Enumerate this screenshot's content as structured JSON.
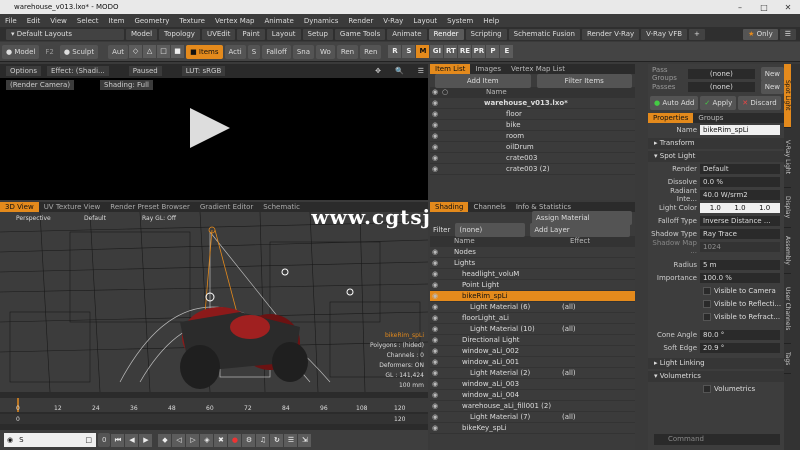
{
  "window": {
    "title": "warehouse_v013.lxo* - MODO"
  },
  "menu": [
    "File",
    "Edit",
    "View",
    "Select",
    "Item",
    "Geometry",
    "Texture",
    "Vertex Map",
    "Animate",
    "Dynamics",
    "Render",
    "V-Ray",
    "Layout",
    "System",
    "Help"
  ],
  "layouts": {
    "default_label": "Default Layouts",
    "tabs": [
      "Model",
      "Topology",
      "UVEdit",
      "Paint",
      "Layout",
      "Setup",
      "Game Tools",
      "Animate",
      "Render",
      "Scripting",
      "Schematic Fusion",
      "Render V-Ray",
      "V-Ray VFB"
    ],
    "active": "Render",
    "only_label": "Only"
  },
  "toolbar": {
    "model": "Model",
    "f2": "F2",
    "sculpt": "Sculpt",
    "auto": "Aut",
    "items": "Items",
    "action": "Acti",
    "s": "S",
    "falloff": "Falloff",
    "snap": "Sna",
    "wo": "Wo",
    "ren1": "Ren",
    "ren2": "Ren",
    "letters": [
      "R",
      "S",
      "M",
      "GI",
      "RT",
      "RE",
      "PR",
      "P",
      "E"
    ]
  },
  "render_view": {
    "options": "Options",
    "effect": "Effect: (Shadi...",
    "status": "Paused",
    "lut": "LUT: sRGB",
    "camera": "(Render Camera)",
    "shading": "Shading: Full"
  },
  "viewport": {
    "tabs": [
      "3D View",
      "UV Texture View",
      "Render Preset Browser",
      "Gradient Editor",
      "Schematic"
    ],
    "active": "3D View",
    "perspective": "Perspective",
    "default": "Default",
    "raygl": "Ray GL: Off",
    "hud_item": "bikeRim_spLi",
    "hud_polys": "Polygons : (hided)",
    "hud_channels": "Channels : 0",
    "hud_deformers": "Deformers: ON",
    "hud_gl": "GL : 141,424",
    "hud_units": "100 mm"
  },
  "timeline": {
    "ticks": [
      "0",
      "12",
      "24",
      "36",
      "48",
      "60",
      "72",
      "84",
      "96",
      "108",
      "120"
    ],
    "start": "0",
    "end": "120",
    "current": "0"
  },
  "watermark": "www.cgtsj.com",
  "item_list": {
    "tabs": [
      "Item List",
      "Images",
      "Vertex Map List"
    ],
    "active": "Item List",
    "add_item": "Add Item",
    "filter": "Filter Items",
    "name_col": "Name",
    "items": [
      {
        "label": "warehouse_v013.lxo*",
        "root": true
      },
      {
        "label": "floor"
      },
      {
        "label": "bike"
      },
      {
        "label": "room"
      },
      {
        "label": "oilDrum"
      },
      {
        "label": "crate003"
      },
      {
        "label": "crate003 (2)"
      }
    ]
  },
  "shading": {
    "tabs": [
      "Shading",
      "Channels",
      "Info & Statistics"
    ],
    "active": "Shading",
    "assign_material": "Assign Material",
    "filter_label": "Filter",
    "filter_value": "(none)",
    "add_layer": "Add Layer",
    "col_name": "Name",
    "col_effect": "Effect",
    "rows": [
      {
        "label": "Nodes",
        "indent": 1,
        "effect": ""
      },
      {
        "label": "Lights",
        "indent": 1,
        "effect": ""
      },
      {
        "label": "headlight_voluM",
        "indent": 2,
        "effect": ""
      },
      {
        "label": "Point Light",
        "indent": 2,
        "effect": ""
      },
      {
        "label": "bikeRim_spLi",
        "indent": 2,
        "effect": "",
        "selected": true
      },
      {
        "label": "Light Material (6)",
        "indent": 3,
        "effect": "(all)"
      },
      {
        "label": "floorLight_aLi",
        "indent": 2,
        "effect": ""
      },
      {
        "label": "Light Material (10)",
        "indent": 3,
        "effect": "(all)"
      },
      {
        "label": "Directional Light",
        "indent": 2,
        "effect": ""
      },
      {
        "label": "window_aLi_002",
        "indent": 2,
        "effect": ""
      },
      {
        "label": "window_aLi_001",
        "indent": 2,
        "effect": ""
      },
      {
        "label": "Light Material (2)",
        "indent": 3,
        "effect": "(all)"
      },
      {
        "label": "window_aLi_003",
        "indent": 2,
        "effect": ""
      },
      {
        "label": "window_aLi_004",
        "indent": 2,
        "effect": ""
      },
      {
        "label": "warehouse_aLi_fill001 (2)",
        "indent": 2,
        "effect": ""
      },
      {
        "label": "Light Material (7)",
        "indent": 3,
        "effect": "(all)"
      },
      {
        "label": "bikeKey_spLi",
        "indent": 2,
        "effect": ""
      }
    ]
  },
  "pass_groups": {
    "pass_label": "Pass Groups",
    "pass_value": "(none)",
    "passes_label": "Passes",
    "passes_value": "(none)",
    "new1": "New",
    "new2": "New",
    "auto_add": "Auto Add",
    "apply": "Apply",
    "discard": "Discard"
  },
  "properties": {
    "tabs": [
      "Properties",
      "Groups"
    ],
    "active": "Properties",
    "name_label": "Name",
    "name_value": "bikeRim_spLi",
    "transform": "Transform",
    "spot_light": "Spot Light",
    "render_label": "Render",
    "render_value": "Default",
    "dissolve_label": "Dissolve",
    "dissolve_value": "0.0 %",
    "radiant_label": "Radiant Inte...",
    "radiant_value": "40.0 W/srm2",
    "color_label": "Light Color",
    "color_values": [
      "1.0",
      "1.0",
      "1.0"
    ],
    "falloff_label": "Falloff Type",
    "falloff_value": "Inverse Distance ...",
    "shadow_label": "Shadow Type",
    "shadow_value": "Ray Trace",
    "shadowmap_label": "Shadow Map ...",
    "shadowmap_value": "1024",
    "radius_label": "Radius",
    "radius_value": "5 m",
    "importance_label": "Importance",
    "importance_value": "100.0 %",
    "visible_camera": "Visible to Camera",
    "visible_reflect": "Visible to Reflecti...",
    "visible_refract": "Visible to Refract...",
    "cone_label": "Cone Angle",
    "cone_value": "80.0 °",
    "soft_label": "Soft Edge",
    "soft_value": "20.9 °",
    "light_linking": "Light Linking",
    "volumetrics": "Volumetrics",
    "volumetrics_chk": "Volumetrics",
    "command": "Command"
  },
  "side_tabs": [
    "Spot Light",
    "V-Ray Light",
    "Display",
    "Assembly",
    "User Channels",
    "Tags"
  ],
  "side_active": "Spot Light",
  "bottom": {
    "search_value": "S",
    "frame": "0"
  },
  "colors": {
    "accent": "#e48a1c",
    "panel": "#3b3b3b",
    "dark": "#2b2b2b",
    "bike_red": "#8c1a1a"
  }
}
